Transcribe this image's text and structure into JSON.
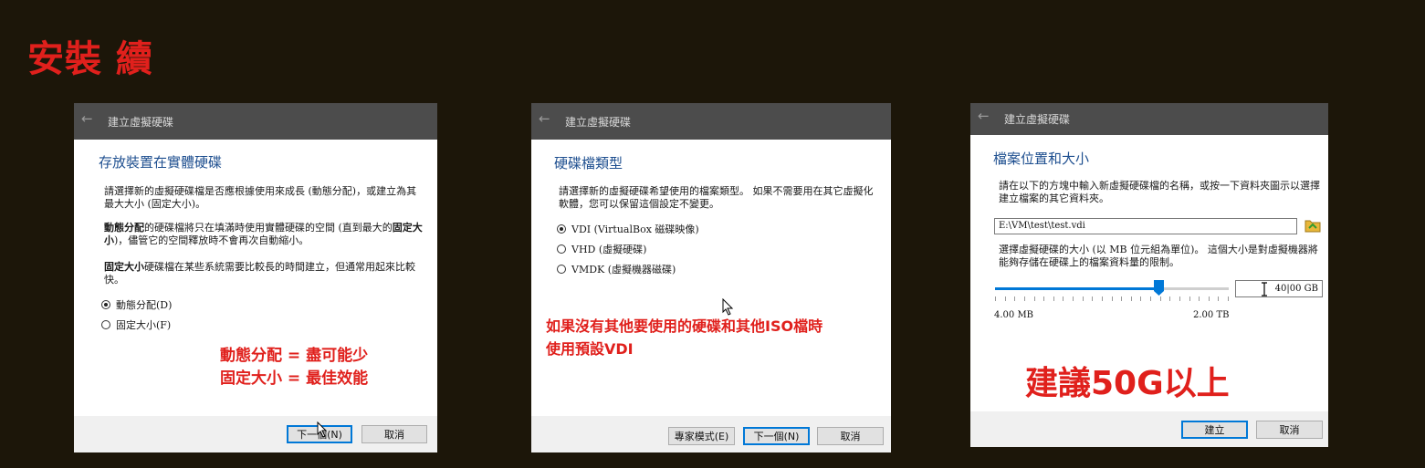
{
  "page": {
    "heading": "安裝 續"
  },
  "dialog1": {
    "title": "建立虛擬硬碟",
    "heading": "存放裝置在實體硬碟",
    "desc1": "請選擇新的虛擬硬碟檔是否應根據使用來成長 (動態分配)，或建立為其最大大小 (固定大小)。",
    "desc2_bold": "動態分配",
    "desc2": "的硬碟檔將只在填滿時使用實體硬碟的空間 (直到最大的",
    "desc2_bold2": "固定大小",
    "desc2_end": ")，儘管它的空間釋放時不會再次自動縮小。",
    "desc3_bold": "固定大小",
    "desc3": "硬碟檔在某些系統需要比較長的時間建立，但通常用起來比較快。",
    "options": [
      "動態分配(D)",
      "固定大小(F)"
    ],
    "selected": 0,
    "annotation_line1": "動態分配 = 盡可能少",
    "annotation_line2": "固定大小 = 最佳效能",
    "next_button": "下一個(N)",
    "cancel_button": "取消"
  },
  "dialog2": {
    "title": "建立虛擬硬碟",
    "heading": "硬碟檔類型",
    "desc": "請選擇新的虛擬硬碟希望使用的檔案類型。 如果不需要用在其它虛擬化軟體，您可以保留這個設定不變更。",
    "options": [
      "VDI (VirtualBox 磁碟映像)",
      "VHD (虛擬硬碟)",
      "VMDK (虛擬機器磁碟)"
    ],
    "selected": 0,
    "annotation_line1": "如果沒有其他要使用的硬碟和其他ISO檔時",
    "annotation_line2": "使用預設VDI",
    "expert_button": "專家模式(E)",
    "next_button": "下一個(N)",
    "cancel_button": "取消"
  },
  "dialog3": {
    "title": "建立虛擬硬碟",
    "heading": "檔案位置和大小",
    "desc1": "請在以下的方塊中輸入新虛擬硬碟檔的名稱，或按一下資料夾圖示以選擇建立檔案的其它資料夾。",
    "path_value": "E:\\VM\\test\\test.vdi",
    "desc2": "選擇虛擬硬碟的大小 (以 MB 位元組為單位)。 這個大小是對虛擬機器將能夠存儲在硬碟上的檔案資料量的限制。",
    "slider_fraction": 0.7,
    "min_label": "4.00 MB",
    "max_label": "2.00 TB",
    "size_value": "40|00 GB",
    "annotation": "建議50G以上",
    "create_button": "建立",
    "cancel_button": "取消"
  },
  "colors": {
    "annotation": "#e0201c",
    "heading": "#1d4e8f",
    "accent": "#0078d7",
    "titlebar": "#4c4c4c"
  },
  "icons": [
    "back-arrow-icon",
    "folder-icon",
    "mouse-cursor-icon",
    "text-cursor-icon",
    "slider-thumb-icon"
  ]
}
